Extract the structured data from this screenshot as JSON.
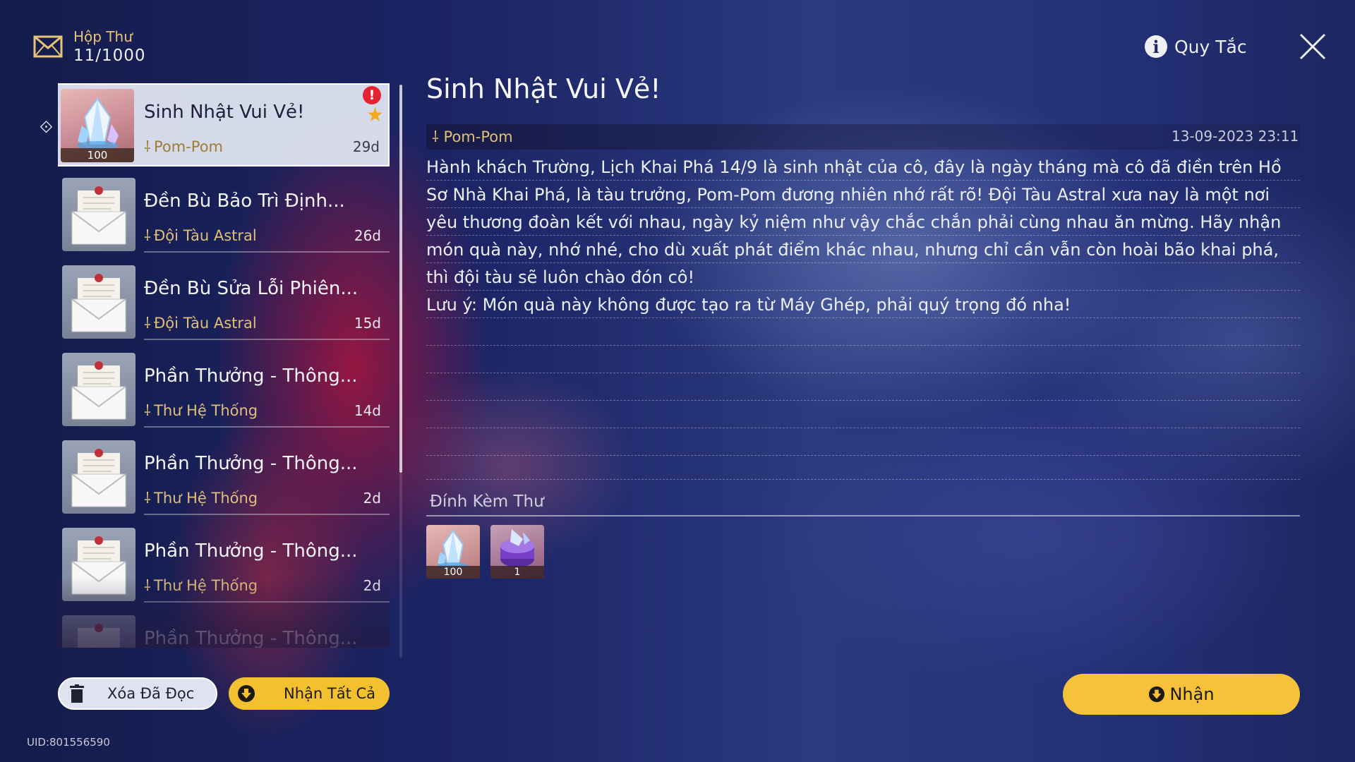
{
  "header": {
    "mailbox_title": "Hộp Thư",
    "mailbox_count": "11/1000",
    "rules_label": "Quy Tắc"
  },
  "mail_list": [
    {
      "title": "Sinh Nhật Vui Vẻ!",
      "sender": "Pom-Pom",
      "age": "29d",
      "selected": true,
      "thumb_count": "100",
      "unread_alert": "!",
      "starred": true
    },
    {
      "title": "Đền Bù Bảo Trì Định...",
      "sender": "Đội Tàu Astral",
      "age": "26d"
    },
    {
      "title": "Đền Bù Sửa Lỗi Phiên...",
      "sender": "Đội Tàu Astral",
      "age": "15d"
    },
    {
      "title": "Phần Thưởng - Thông...",
      "sender": "Thư Hệ Thống",
      "age": "14d"
    },
    {
      "title": "Phần Thưởng - Thông...",
      "sender": "Thư Hệ Thống",
      "age": "2d"
    },
    {
      "title": "Phần Thưởng - Thông...",
      "sender": "Thư Hệ Thống",
      "age": "2d"
    },
    {
      "title": "Phần Thưởng - Thông..."
    }
  ],
  "detail": {
    "title": "Sinh Nhật Vui Vẻ!",
    "sender": "Pom-Pom",
    "date": "13-09-2023 23:11",
    "body": "Hành khách Trường, Lịch Khai Phá 14/9 là sinh nhật của cô, đây là ngày tháng mà cô đã điền trên Hồ Sơ Nhà Khai Phá, là tàu trưởng, Pom-Pom đương nhiên nhớ rất rõ! Đội Tàu Astral xưa nay là một nơi yêu thương đoàn kết với nhau, ngày kỷ niệm như vậy chắc chắn phải cùng nhau ăn mừng. Hãy nhận món quà này, nhớ nhé, cho dù xuất phát điểm khác nhau, nhưng chỉ cần vẫn còn hoài bão khai phá, thì đội tàu sẽ luôn chào đón cô!",
    "note": "Lưu ý: Món quà này không được tạo ra từ Máy Ghép, phải quý trọng đó nha!",
    "attachments_label": "Đính Kèm Thư",
    "attachments": [
      {
        "icon": "stellar-jade-crystal-icon",
        "count": "100"
      },
      {
        "icon": "purple-relic-item-icon",
        "count": "1"
      }
    ]
  },
  "buttons": {
    "delete_read": "Xóa Đã Đọc",
    "claim_all": "Nhận Tất Cả",
    "claim": "Nhận"
  },
  "footer": {
    "uid": "UID:801556590"
  },
  "colors": {
    "accent_gold": "#f3c12f",
    "sender_gold": "#e0bf78",
    "alert_red": "#e52330"
  }
}
